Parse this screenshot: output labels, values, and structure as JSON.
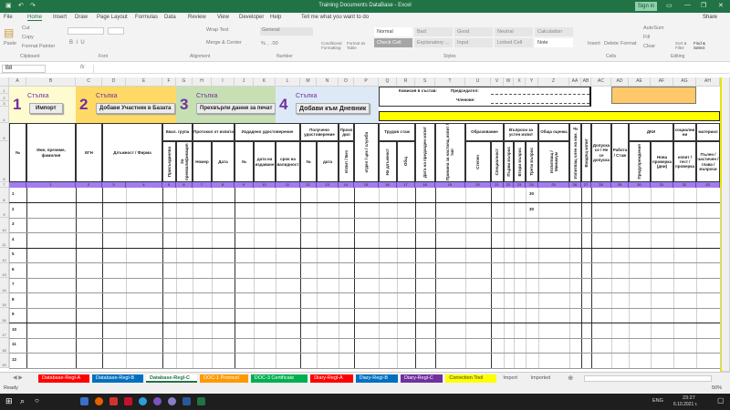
{
  "window": {
    "title": "Training Documents DataBase - Excel",
    "sign_in": "Sign in"
  },
  "menu": [
    "File",
    "Home",
    "Insert",
    "Draw",
    "Page Layout",
    "Formulas",
    "Data",
    "Review",
    "View",
    "Developer",
    "Help"
  ],
  "tell_me": "Tell me what you want to do",
  "share": "Share",
  "ribbon": {
    "clipboard": {
      "paste": "Paste",
      "cut": "Cut",
      "copy": "Copy",
      "format_painter": "Format Painter",
      "label": "Clipboard"
    },
    "font": {
      "label": "Font"
    },
    "alignment": {
      "wrap": "Wrap Text",
      "merge": "Merge & Center",
      "label": "Alignment"
    },
    "number": {
      "format": "General",
      "label": "Number"
    },
    "cf": "Conditional Formatting",
    "fat": "Format as Table",
    "styles": {
      "label": "Styles",
      "items": [
        "Normal",
        "Bad",
        "Good",
        "Neutral",
        "Calculation",
        "Check Cell",
        "Explanatory ...",
        "Input",
        "Linked Cell",
        "Note"
      ]
    },
    "cells": {
      "label": "Cells",
      "insert": "Insert",
      "delete": "Delete",
      "format": "Format"
    },
    "editing": {
      "label": "Editing",
      "autosum": "AutoSum",
      "fill": "Fill",
      "clear": "Clear",
      "sort": "Sort & Filter",
      "find": "Find & Select"
    }
  },
  "name_box": "B8",
  "fx": "fx",
  "columns": [
    "A",
    "B",
    "C",
    "D",
    "E",
    "F",
    "G",
    "H",
    "I",
    "J",
    "K",
    "L",
    "M",
    "N",
    "O",
    "P",
    "Q",
    "R",
    "S",
    "T",
    "U",
    "V",
    "W",
    "X",
    "Y",
    "Z",
    "AA",
    "AB",
    "AC",
    "AD",
    "AE",
    "AF",
    "AG",
    "AH"
  ],
  "row_numbers": [
    "1",
    "2",
    "3",
    "4",
    "5",
    "6",
    "7",
    "8",
    "9",
    "10",
    "11",
    "12",
    "13",
    "14",
    "15",
    "16",
    "17",
    "18",
    "19"
  ],
  "steps": [
    {
      "num": "1",
      "label": "Стъпка",
      "button": "Импорт",
      "color": "#fffbd0"
    },
    {
      "num": "2",
      "label": "Стъпка",
      "button": "Добави Участник в Базата",
      "color": "#ffd966"
    },
    {
      "num": "3",
      "label": "Стъпка",
      "button": "Прехвърли данни за печат",
      "color": "#c6e0b4"
    },
    {
      "num": "4",
      "label": "Стъпка",
      "button": "Добави към Дневник",
      "color": "#dde9f6"
    }
  ],
  "commission": {
    "label": "Комисия в състав:",
    "chairman": "Председател:",
    "members": "Членове:"
  },
  "h": {
    "no": "№",
    "name": "Име, презиме, фамилия",
    "egn": "ЕГН",
    "position": "Длъжност / Фирма",
    "qual": "Квал. група",
    "qual_a": "Присъединява",
    "qual_b": "За преквалификация",
    "protocol": "Протокол от изпита",
    "number": "Номер",
    "date": "Дата",
    "issued": "Издадено удостоверение",
    "issued_no": "№",
    "issued_date": "дата на издаване",
    "validity": "срок на валидност",
    "received": "Получено удостоверение",
    "received_no": "№",
    "received_date": "дата",
    "passed": "Прохо дил",
    "passed_sub": "Изпит / Без",
    "dept": "отдел / цех / служба",
    "experience": "Трудов стаж",
    "exp_position": "На длъжност",
    "exp_total": "Общ",
    "prev_exam": "Дата на предходен изпит",
    "reason": "Причина за настоящ изпит / тип",
    "education": "Образование",
    "degree": "Степен",
    "specialty": "Специалност",
    "questions": "Въпроси за устен изпит",
    "q1": "Първи въпрос",
    "q2": "Втори въпрос",
    "q3": "Трети въпрос",
    "grade": "Обща оценка",
    "grade_sub": "Изпитващ / Минимум",
    "examiner": "Изпитващ член на ком. №",
    "entry": "Входящ изпит",
    "admitted": "Допуска се / Не се допуска",
    "work": "Работа / Стаж",
    "dki": "ДКИ",
    "warnings": "Предупреждения",
    "recheck": "Нова проверка (дни)",
    "social": "социални ни",
    "exam_type": "изпит / тест / проверка",
    "material": "материал",
    "material_sub": "Пълен / частичен / глава / въпроси"
  },
  "col_numbers": [
    "",
    "1",
    "2",
    "3",
    "4",
    "5",
    "6",
    "7",
    "8",
    "9",
    "10",
    "11",
    "12",
    "13",
    "14",
    "15",
    "16",
    "17",
    "18",
    "19",
    "20",
    "21",
    "22",
    "23",
    "24",
    "25",
    "26",
    "27",
    "28",
    "29",
    "30",
    "31",
    "32",
    "33"
  ],
  "rows": [
    {
      "no": "1",
      "y": "30"
    },
    {
      "no": "2",
      "y": "30"
    },
    {
      "no": "3",
      "y": ""
    },
    {
      "no": "4",
      "y": ""
    },
    {
      "no": "5",
      "y": ""
    },
    {
      "no": "6",
      "y": ""
    },
    {
      "no": "7",
      "y": ""
    },
    {
      "no": "8",
      "y": ""
    },
    {
      "no": "9",
      "y": ""
    },
    {
      "no": "10",
      "y": ""
    },
    {
      "no": "11",
      "y": ""
    },
    {
      "no": "12",
      "y": ""
    }
  ],
  "sheet_tabs": [
    {
      "label": "Database-Regl-A",
      "color": "#ff0000",
      "fg": "#ffffff"
    },
    {
      "label": "Database-Regl-B",
      "color": "#0070c0",
      "fg": "#ffffff"
    },
    {
      "label": "Database-Regl-C",
      "color": "#ffffff",
      "fg": "#217346",
      "active": true
    },
    {
      "label": "DOC-1 Protocol",
      "color": "#ff9900",
      "fg": "#ffffff"
    },
    {
      "label": "DOC-3 Certificate",
      "color": "#00b050",
      "fg": "#ffffff"
    },
    {
      "label": "Diary-Regl-A",
      "color": "#ff0000",
      "fg": "#ffffff"
    },
    {
      "label": "Diary-Regl-B",
      "color": "#0070c0",
      "fg": "#ffffff"
    },
    {
      "label": "Diary-Regl-C",
      "color": "#7030a0",
      "fg": "#ffffff"
    },
    {
      "label": "Correction Tool",
      "color": "#ffff00",
      "fg": "#333333"
    },
    {
      "label": "Import",
      "color": "#f0f0f0",
      "fg": "#555555"
    },
    {
      "label": "Imported",
      "color": "#f0f0f0",
      "fg": "#555555"
    }
  ],
  "add_sheet": "⊕",
  "status": {
    "ready": "Ready",
    "zoom": "50%"
  },
  "taskbar": {
    "lang": "ENG",
    "time": "23:27",
    "date": "6.10.2021 г."
  }
}
